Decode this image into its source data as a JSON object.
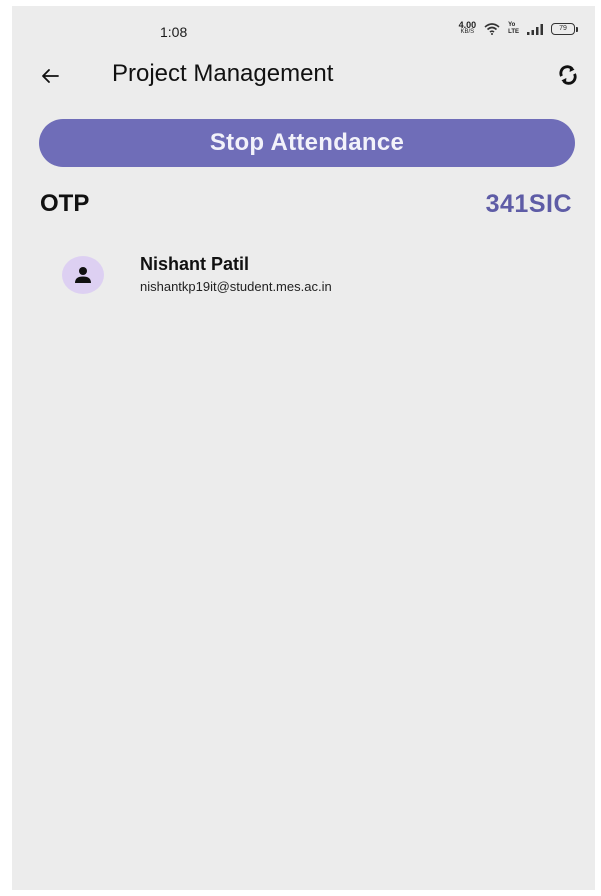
{
  "status_bar": {
    "time": "1:08",
    "net_speed_value": "4.00",
    "net_speed_unit": "KB/S",
    "volte_top": "Yo",
    "volte_bottom": "LTE",
    "battery": "79"
  },
  "header": {
    "title": "Project Management",
    "back_icon": "arrow-left-icon",
    "refresh_icon": "refresh-icon"
  },
  "actions": {
    "stop_label": "Stop Attendance"
  },
  "otp": {
    "label": "OTP",
    "value": "341SIC"
  },
  "students": [
    {
      "name": "Nishant Patil",
      "email": "nishantkp19it@student.mes.ac.in",
      "icon": "person-icon"
    }
  ],
  "colors": {
    "accent": "#6f6db8",
    "otp_value": "#5e5ca6",
    "avatar_bg": "#ddd0f2",
    "background": "#ececec"
  }
}
